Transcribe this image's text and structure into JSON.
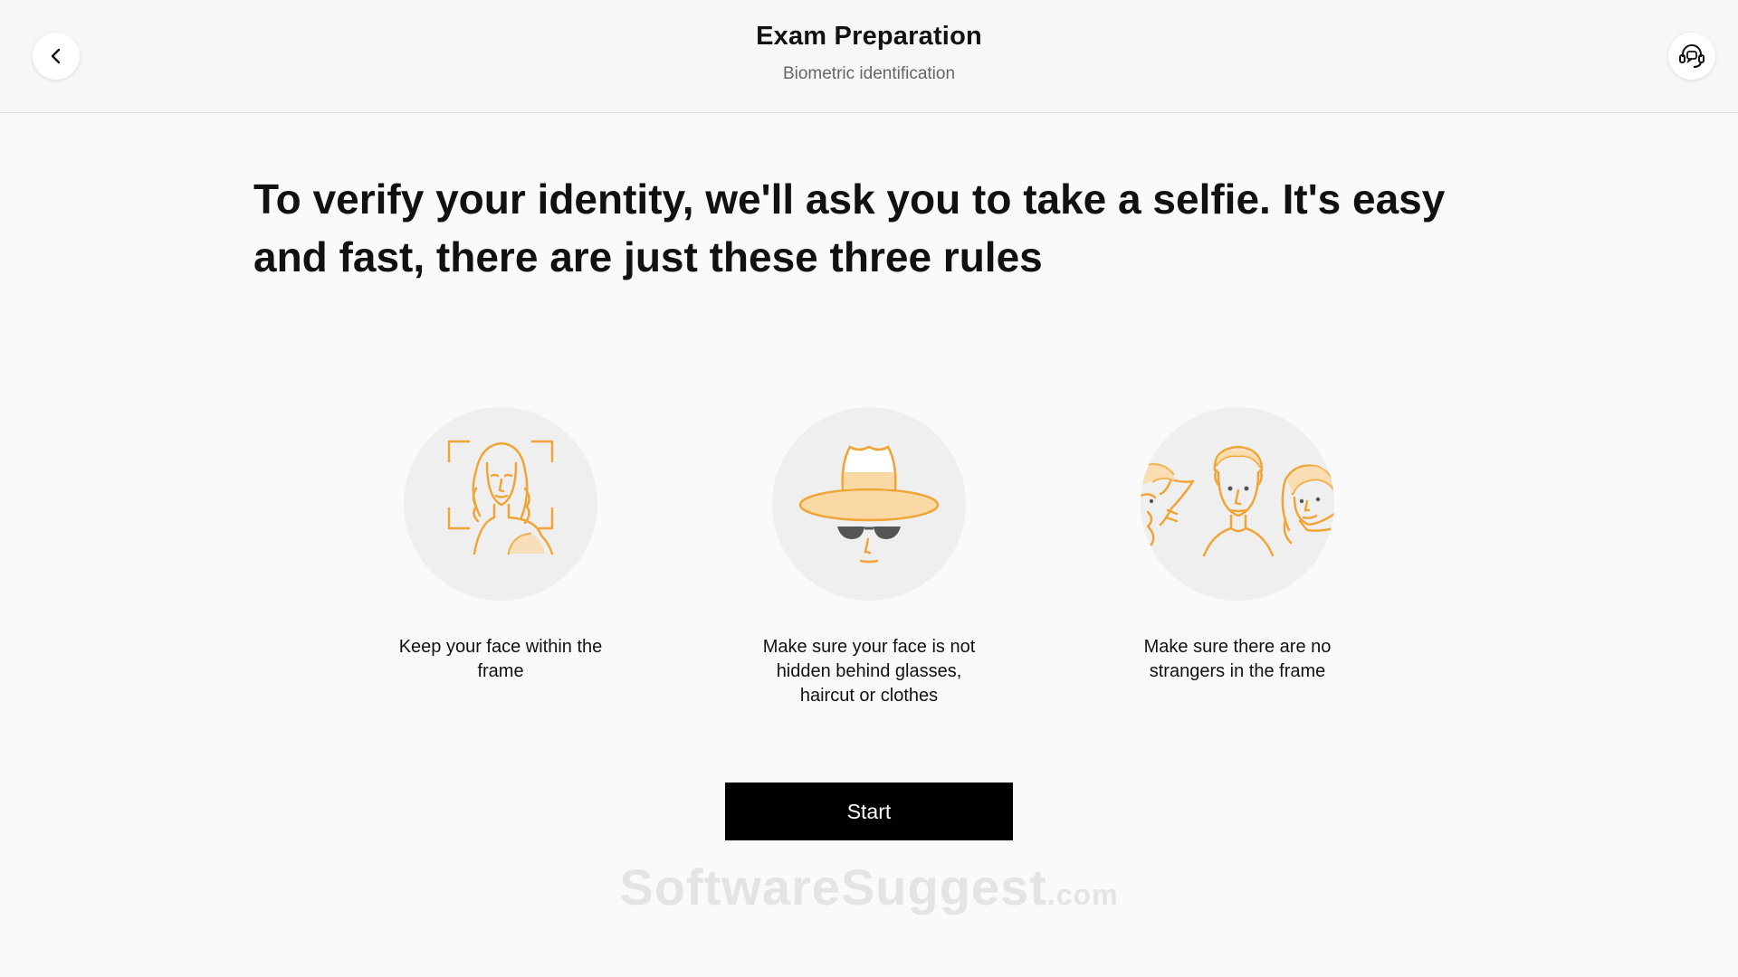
{
  "header": {
    "title": "Exam Preparation",
    "subtitle": "Biometric identification",
    "back_icon": "chevron-left-icon",
    "support_icon": "headset-support-icon"
  },
  "main": {
    "headline": "To verify your identity, we'll ask you to take a selfie. It's easy and fast, there are just these three rules",
    "rules": [
      {
        "icon": "face-in-frame-illustration",
        "text": "Keep your face within the frame"
      },
      {
        "icon": "hat-and-sunglasses-illustration",
        "text": "Make sure your face is not hidden behind glasses, haircut or clothes"
      },
      {
        "icon": "strangers-in-frame-illustration",
        "text": "Make sure there are no strangers in the frame"
      }
    ],
    "start_label": "Start"
  },
  "watermark": {
    "text": "SoftwareSuggest",
    "suffix": ".com"
  },
  "colors": {
    "accent": "#f0a537",
    "accent_fill": "#fbd9a5",
    "circle_bg": "#efefef",
    "button_bg": "#000000"
  }
}
